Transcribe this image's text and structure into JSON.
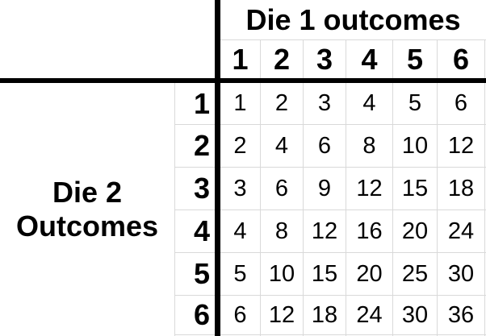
{
  "table": {
    "col_title": "Die 1 outcomes",
    "row_title_line1": "Die 2",
    "row_title_line2": "Outcomes",
    "col_headers": [
      "1",
      "2",
      "3",
      "4",
      "5",
      "6"
    ],
    "row_headers": [
      "1",
      "2",
      "3",
      "4",
      "5",
      "6"
    ],
    "rows": [
      [
        "1",
        "2",
        "3",
        "4",
        "5",
        "6"
      ],
      [
        "2",
        "4",
        "6",
        "8",
        "10",
        "12"
      ],
      [
        "3",
        "6",
        "9",
        "12",
        "15",
        "18"
      ],
      [
        "4",
        "8",
        "12",
        "16",
        "20",
        "24"
      ],
      [
        "5",
        "10",
        "15",
        "20",
        "25",
        "30"
      ],
      [
        "6",
        "12",
        "18",
        "24",
        "30",
        "36"
      ]
    ]
  },
  "colors": {
    "text": "#000000",
    "grid": "#d9d9d9",
    "border": "#000000"
  }
}
